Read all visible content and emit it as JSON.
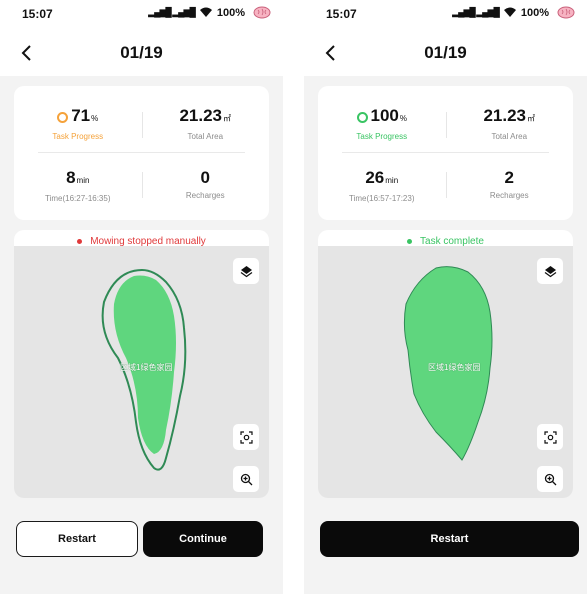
{
  "screens": [
    {
      "status_time": "15:07",
      "battery": "100%",
      "title": "01/19",
      "task_progress_value": "71",
      "task_progress_unit": "%",
      "task_progress_label": "Task Progress",
      "total_area_value": "21.23",
      "total_area_unit": "㎡",
      "total_area_label": "Total Area",
      "time_value": "8",
      "time_unit": "min",
      "time_label": "Time(16:27-16:35)",
      "recharges_value": "0",
      "recharges_label": "Recharges",
      "map_status": "Mowing stopped manually",
      "zone_label": "区域1绿色家园",
      "buttons": [
        "Restart",
        "Continue"
      ]
    },
    {
      "status_time": "15:07",
      "battery": "100%",
      "title": "01/19",
      "task_progress_value": "100",
      "task_progress_unit": "%",
      "task_progress_label": "Task Progress",
      "total_area_value": "21.23",
      "total_area_unit": "㎡",
      "total_area_label": "Total Area",
      "time_value": "26",
      "time_unit": "min",
      "time_label": "Time(16:57-17:23)",
      "recharges_value": "2",
      "recharges_label": "Recharges",
      "map_status": "Task complete",
      "zone_label": "区域1绿色家园",
      "buttons": [
        "Restart"
      ]
    }
  ],
  "colors": {
    "progress_partial": "#f5a23a",
    "progress_complete": "#39c463",
    "status_stopped": "#e0393a",
    "status_complete": "#39c463",
    "lawn": "#5fd67e",
    "boundary": "#2f8a55"
  },
  "icons": [
    "wifi-icon",
    "brain-icon",
    "back-icon",
    "layers-icon",
    "locate-icon",
    "zoom-in-icon"
  ]
}
